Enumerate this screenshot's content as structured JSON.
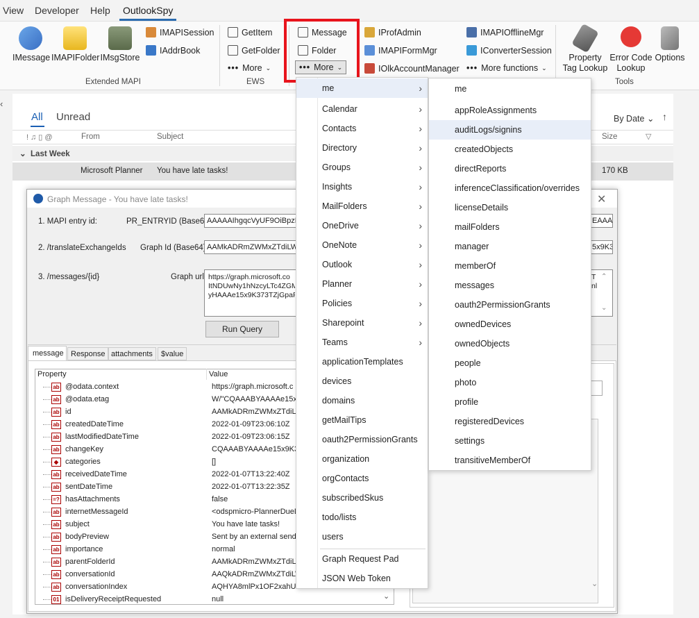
{
  "menubar": {
    "items": [
      "View",
      "Developer",
      "Help",
      "OutlookSpy"
    ]
  },
  "ribbon": {
    "extended": {
      "imessage": "IMessage",
      "imapifolder": "IMAPIFolder",
      "imsgstore": "IMsgStore",
      "imapisession": "IMAPISession",
      "iaddrbook": "IAddrBook",
      "group": "Extended MAPI"
    },
    "ews": {
      "getitem": "GetItem",
      "getfolder": "GetFolder",
      "more": "More",
      "group": "EWS"
    },
    "graph": {
      "message": "Message",
      "folder": "Folder",
      "more": "More"
    },
    "misc": {
      "iprofadmin": "IProfAdmin",
      "imapiformmgr": "IMAPIFormMgr",
      "iolkaccountmanager": "IOlkAccountManager",
      "imapiofflinemgr": "IMAPIOfflineMgr",
      "iconvertersession": "IConverterSession",
      "more_functions": "More functions"
    },
    "tools": {
      "prop_tag_lookup_1": "Property",
      "prop_tag_lookup_2": "Tag Lookup",
      "error_code_1": "Error Code",
      "error_code_2": "Lookup",
      "options": "Options",
      "group": "Tools"
    }
  },
  "mail": {
    "tab_all": "All",
    "tab_unread": "Unread",
    "sort": "By Date",
    "col_from": "From",
    "col_subject": "Subject",
    "col_size": "Size",
    "group": "Last Week",
    "row_from": "Microsoft Planner",
    "row_subject": "You have late tasks!",
    "row_size": "170 KB"
  },
  "dialog": {
    "title": "Graph Message - You have late tasks!",
    "l1": "1. MAPI entry id:",
    "l1b": "PR_ENTRYID (Base64)",
    "v1": "AAAAAIhgqcVyUF9OiBpzK",
    "v1r": "EAAA2",
    "l2": "2. /translateExchangeIds",
    "l2b": "Graph Id (Base64)",
    "v2": "AAMkADRmZWMxZTdiLWE",
    "v2r": "5x9K3",
    "l3": "3. /messages/{id}",
    "l3b": "Graph url",
    "v3a": "https://graph.microsoft.co",
    "v3b": "ItNDUwNy1hNzcyLTc4ZGM",
    "v3c": "yHAAAe15x9K373TZjGpaF",
    "v3r1": "T",
    "v3r2": "nl",
    "run": "Run Query",
    "tabs": [
      "message",
      "Response",
      "attachments",
      "$value"
    ],
    "col_prop": "Property",
    "col_value": "Value",
    "rows": [
      {
        "n": "@odata.context",
        "v": "https://graph.microsoft.c"
      },
      {
        "n": "@odata.etag",
        "v": "W/\"CQAAABYAAAAe15x9"
      },
      {
        "n": "id",
        "v": "AAMkADRmZWMxZTdiLW"
      },
      {
        "n": "createdDateTime",
        "v": "2022-01-09T23:06:10Z"
      },
      {
        "n": "lastModifiedDateTime",
        "v": "2022-01-09T23:06:15Z"
      },
      {
        "n": "changeKey",
        "v": "CQAAABYAAAAe15x9K3"
      },
      {
        "n": "categories",
        "v": "[]"
      },
      {
        "n": "receivedDateTime",
        "v": "2022-01-07T13:22:40Z"
      },
      {
        "n": "sentDateTime",
        "v": "2022-01-07T13:22:35Z"
      },
      {
        "n": "hasAttachments",
        "v": "false"
      },
      {
        "n": "internetMessageId",
        "v": "<odspmicro-PlannerDueD"
      },
      {
        "n": "subject",
        "v": "You have late tasks!"
      },
      {
        "n": "bodyPreview",
        "v": "Sent by an external send"
      },
      {
        "n": "importance",
        "v": "normal"
      },
      {
        "n": "parentFolderId",
        "v": "AAMkADRmZWMxZTdiLW"
      },
      {
        "n": "conversationId",
        "v": "AAQkADRmZWMxZTdiLW"
      },
      {
        "n": "conversationIndex",
        "v": "AQHYA8mlPx1OF2xahUu"
      },
      {
        "n": "isDeliveryReceiptRequested",
        "v": "null"
      }
    ]
  },
  "menu1": {
    "items": [
      "me",
      "Calendar",
      "Contacts",
      "Directory",
      "Groups",
      "Insights",
      "MailFolders",
      "OneDrive",
      "OneNote",
      "Outlook",
      "Planner",
      "Policies",
      "Sharepoint",
      "Teams",
      "applicationTemplates",
      "devices",
      "domains",
      "getMailTips",
      "oauth2PermissionGrants",
      "organization",
      "orgContacts",
      "subscribedSkus",
      "todo/lists",
      "users"
    ],
    "extra": [
      "Graph Request Pad",
      "JSON Web Token"
    ]
  },
  "menu2": {
    "items": [
      "me",
      "appRoleAssignments",
      "auditLogs/signins",
      "createdObjects",
      "directReports",
      "inferenceClassification/overrides",
      "licenseDetails",
      "mailFolders",
      "manager",
      "memberOf",
      "messages",
      "oauth2PermissionGrants",
      "ownedDevices",
      "ownedObjects",
      "people",
      "photo",
      "profile",
      "registeredDevices",
      "settings",
      "transitiveMemberOf"
    ]
  }
}
